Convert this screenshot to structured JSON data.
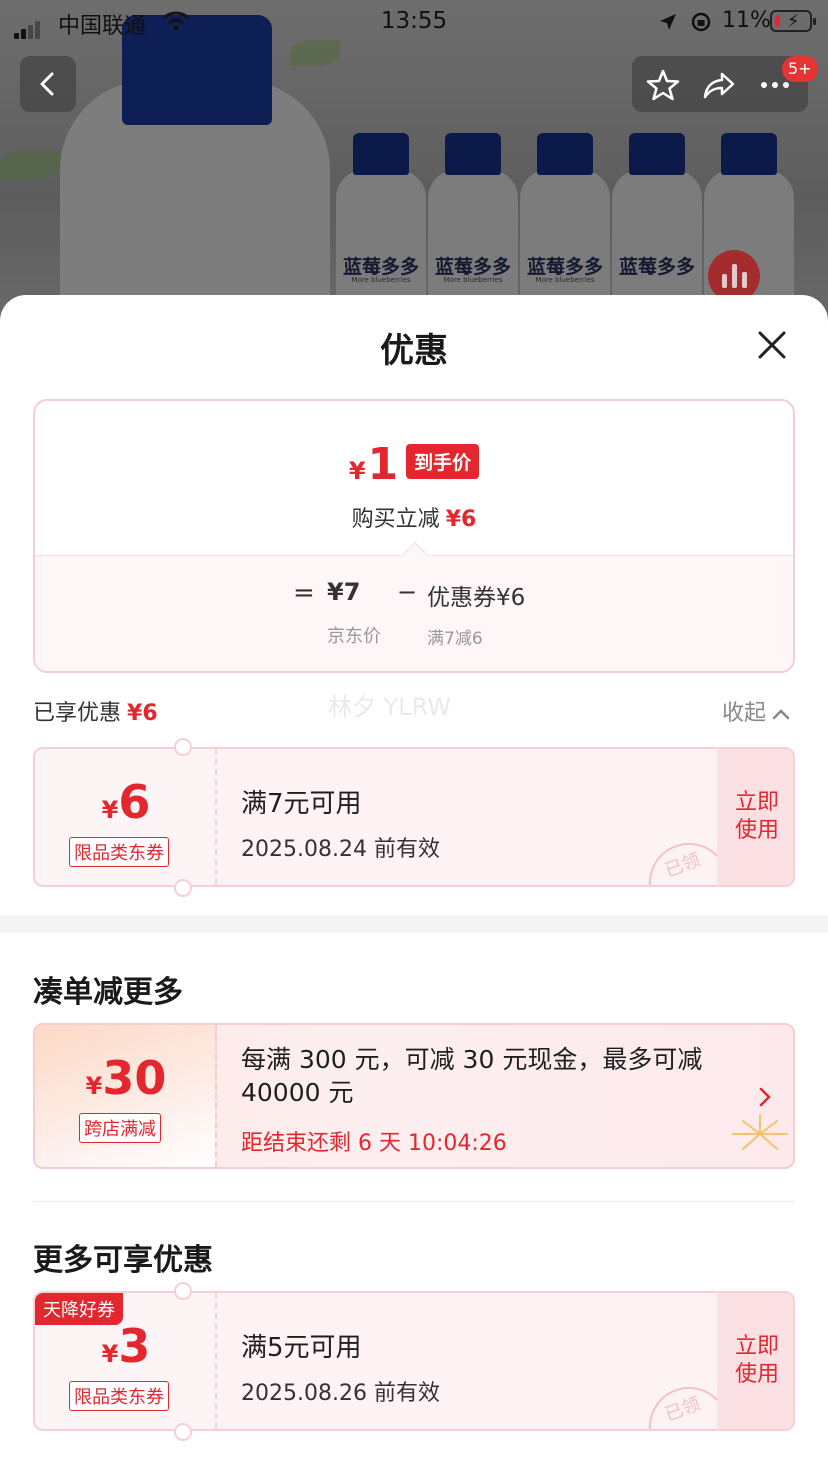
{
  "status_bar": {
    "carrier": "中国联通",
    "time": "13:55",
    "battery": "11%"
  },
  "product_image": {
    "bottle_brand": "蓝莓多多",
    "bottle_brand_en": "More blueberries"
  },
  "nav": {
    "badge": "5+"
  },
  "sheet": {
    "title": "优惠",
    "summary": {
      "currency": "¥",
      "final_price": "1",
      "final_price_tag": "到手价",
      "buy_reduce_label": "购买立减",
      "buy_reduce_value": "¥6",
      "equals": "=",
      "jd_price": "¥7",
      "jd_price_label": "京东价",
      "minus": "−",
      "coupon_label": "优惠券¥6",
      "coupon_condition": "满7减6"
    },
    "enjoyed": {
      "label": "已享优惠",
      "value": "¥6",
      "collapse_label": "收起",
      "watermark": "林夕 YLRW"
    },
    "coupon_1": {
      "currency": "¥",
      "amount": "6",
      "type": "限品类东券",
      "condition": "满7元可用",
      "expiry": "2025.08.24 前有效",
      "use_line1": "立即",
      "use_line2": "使用",
      "stamp": "已领"
    },
    "section_more_orders": {
      "title": "凑单减更多",
      "promo": {
        "currency": "¥",
        "amount": "30",
        "type": "跨店满减",
        "description": "每满 300 元，可减 30 元现金，最多可减 40000 元",
        "countdown": "距结束还剩 6 天 10:04:26"
      }
    },
    "section_more_benefits": {
      "title": "更多可享优惠",
      "coupon": {
        "badge": "天降好券",
        "currency": "¥",
        "amount": "3",
        "type": "限品类东券",
        "condition": "满5元可用",
        "expiry": "2025.08.26 前有效",
        "use_line1": "立即",
        "use_line2": "使用",
        "stamp": "已领"
      }
    }
  },
  "colors": {
    "accent_red": "#e4262e",
    "coupon_border": "#f7cfd5",
    "coupon_bg": "#fdf2f4"
  }
}
